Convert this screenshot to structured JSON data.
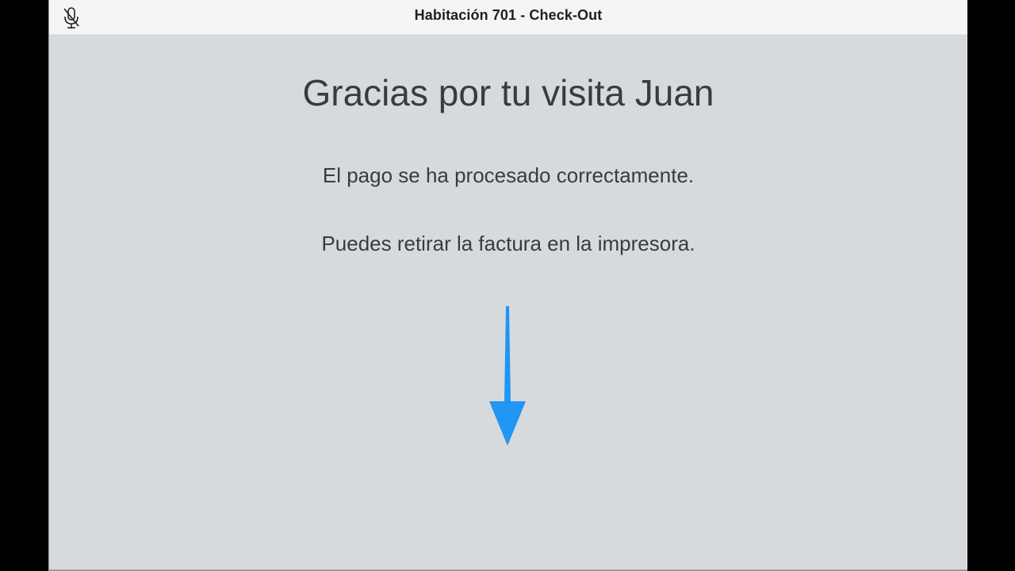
{
  "window": {
    "title": "Habitación 701 - Check-Out"
  },
  "icons": {
    "mic": "microphone-off-icon",
    "arrow": "arrow-down-icon"
  },
  "content": {
    "headline": "Gracias por tu visita Juan",
    "payment_message": "El pago se ha procesado correctamente.",
    "invoice_message": "Puedes retirar la factura en la impresora."
  },
  "colors": {
    "background": "#d7dadd",
    "titlebar": "#f5f5f5",
    "text": "#3a3b3d",
    "arrow": "#2196f3"
  }
}
